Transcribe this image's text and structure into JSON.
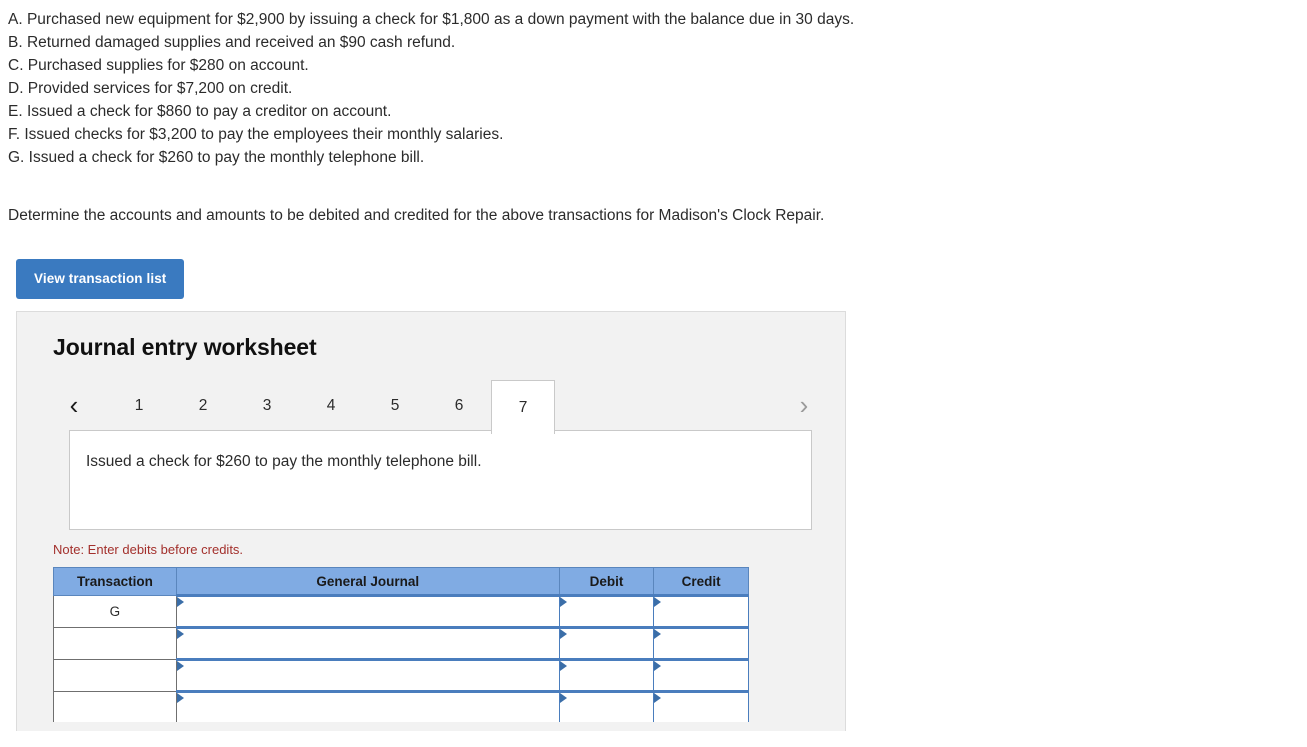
{
  "transactions": [
    "A. Purchased new equipment for $2,900 by issuing a check for $1,800 as a down payment with the balance due in 30 days.",
    "B. Returned damaged supplies and received an $90 cash refund.",
    "C. Purchased supplies for $280 on account.",
    "D. Provided services for $7,200 on credit.",
    "E. Issued a check for $860 to pay a creditor on account.",
    " F. Issued checks for $3,200 to pay the employees their monthly salaries.",
    "G. Issued a check for $260 to pay the monthly telephone bill."
  ],
  "prompt": "Determine the accounts and amounts to be debited and credited for the above transactions for Madison's Clock Repair.",
  "buttons": {
    "view_transaction_list": "View transaction list"
  },
  "worksheet": {
    "title": "Journal entry worksheet",
    "nav": {
      "prev_icon": "chevron-left-icon",
      "prev_glyph": "‹",
      "next_icon": "chevron-right-icon",
      "next_glyph": "›"
    },
    "tabs": [
      {
        "label": "1",
        "active": false
      },
      {
        "label": "2",
        "active": false
      },
      {
        "label": "3",
        "active": false
      },
      {
        "label": "4",
        "active": false
      },
      {
        "label": "5",
        "active": false
      },
      {
        "label": "6",
        "active": false
      },
      {
        "label": "7",
        "active": true
      }
    ],
    "description": "Issued a check for $260 to pay the monthly telephone bill.",
    "note": "Note: Enter debits before credits.",
    "table": {
      "headers": [
        "Transaction",
        "General Journal",
        "Debit",
        "Credit"
      ],
      "rows": [
        {
          "transaction": "G",
          "general_journal": "",
          "debit": "",
          "credit": ""
        },
        {
          "transaction": "",
          "general_journal": "",
          "debit": "",
          "credit": ""
        },
        {
          "transaction": "",
          "general_journal": "",
          "debit": "",
          "credit": ""
        },
        {
          "transaction": "",
          "general_journal": "",
          "debit": "",
          "credit": ""
        }
      ]
    }
  },
  "colors": {
    "button_blue": "#3a7ac0",
    "table_header_blue": "#80abe3",
    "cell_border_blue": "#4a7dbd",
    "note_red": "#a3302c",
    "panel_gray": "#f2f2f2"
  }
}
